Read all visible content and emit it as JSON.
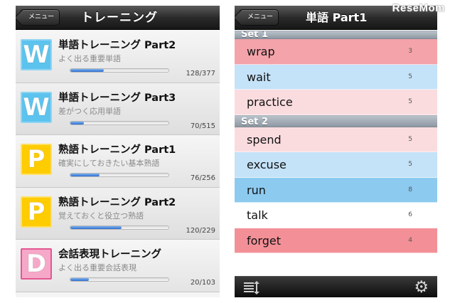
{
  "left": {
    "back_label": "メニュー",
    "title": "トレーニング",
    "courses": [
      {
        "badge": "W",
        "badge_type": "badge-w",
        "title": "単語トレーニング Part2",
        "subtitle": "よく出る重要単語",
        "count": "128/377",
        "progress": 0.34
      },
      {
        "badge": "W",
        "badge_type": "badge-w",
        "title": "単語トレーニング Part3",
        "subtitle": "差がつく応用単語",
        "count": "70/515",
        "progress": 0.14
      },
      {
        "badge": "P",
        "badge_type": "badge-p",
        "title": "熟語トレーニング Part1",
        "subtitle": "確実にしておきたい基本熟語",
        "count": "76/256",
        "progress": 0.3
      },
      {
        "badge": "P",
        "badge_type": "badge-p",
        "title": "熟語トレーニング Part2",
        "subtitle": "覚えておくと役立つ熟語",
        "count": "120/229",
        "progress": 0.52
      },
      {
        "badge": "D",
        "badge_type": "badge-d",
        "title": "会話表現トレーニング",
        "subtitle": "よく出る重要会話表現",
        "count": "20/103",
        "progress": 0.19
      }
    ]
  },
  "right": {
    "back_label": "メニュー",
    "title": "単語 Part1",
    "sections": [
      {
        "header": "Set 1",
        "words": [
          {
            "word": "wrap",
            "count": "3",
            "color": "#f4a3aa"
          },
          {
            "word": "wait",
            "count": "5",
            "color": "#c4e2f8"
          },
          {
            "word": "practice",
            "count": "5",
            "color": "#fadcdf"
          }
        ]
      },
      {
        "header": "Set 2",
        "words": [
          {
            "word": "spend",
            "count": "5",
            "color": "#fadcdf"
          },
          {
            "word": "excuse",
            "count": "5",
            "color": "#c4e2f8"
          },
          {
            "word": "run",
            "count": "8",
            "color": "#8ccaf0"
          },
          {
            "word": "talk",
            "count": "6",
            "color": "#ffffff"
          },
          {
            "word": "forget",
            "count": "4",
            "color": "#f39097"
          }
        ]
      }
    ],
    "toolbar": {
      "left_icon": "list-sort-icon",
      "right_icon": "gear-icon"
    }
  },
  "watermark": "ReseMom"
}
